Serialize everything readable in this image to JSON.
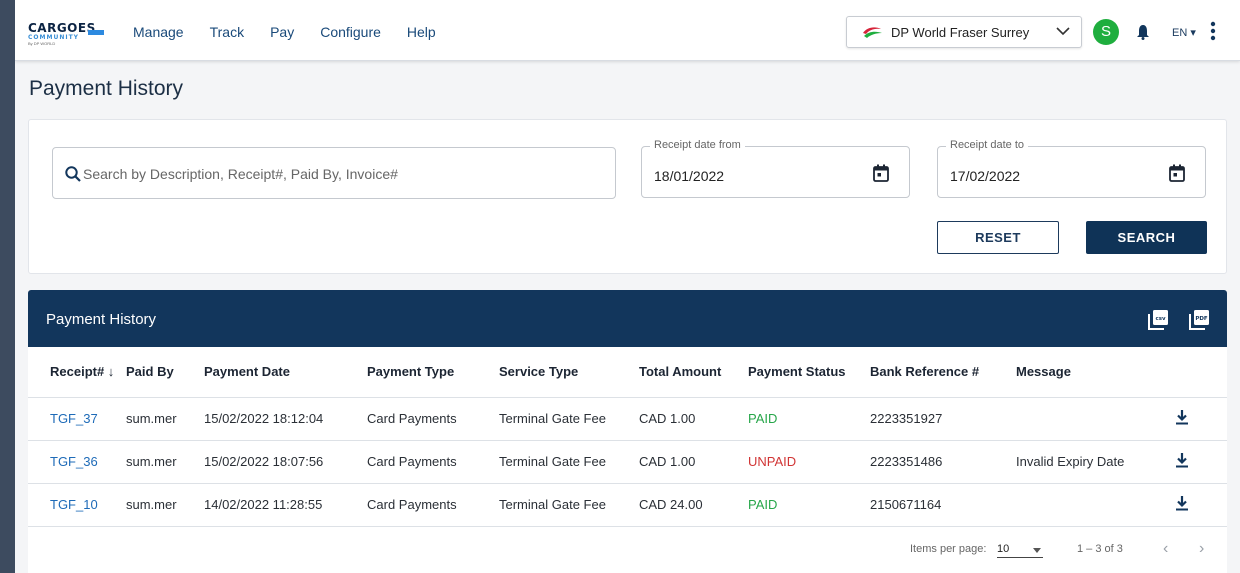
{
  "brand": {
    "line1": "CARGOES",
    "line2": "COMMUNITY",
    "line3": "By DP WORLD"
  },
  "nav": [
    "Manage",
    "Track",
    "Pay",
    "Configure",
    "Help"
  ],
  "terminal": {
    "selected": "DP World Fraser Surrey"
  },
  "user": {
    "initial": "S"
  },
  "language": "EN ▾",
  "page": {
    "title": "Payment History"
  },
  "filters": {
    "search_placeholder": "Search by Description, Receipt#, Paid By, Invoice#",
    "date_from": {
      "label": "Receipt date from",
      "value": "18/01/2022"
    },
    "date_to": {
      "label": "Receipt date to",
      "value": "17/02/2022"
    },
    "reset_label": "RESET",
    "search_label": "SEARCH"
  },
  "table": {
    "title": "Payment History",
    "export_icons": [
      "csv-export-icon",
      "pdf-export-icon"
    ],
    "columns": [
      "Receipt# ↓",
      "Paid By",
      "Payment Date",
      "Payment Type",
      "Service Type",
      "Total Amount",
      "Payment Status",
      "Bank Reference #",
      "Message"
    ],
    "rows": [
      {
        "receipt": "TGF_37",
        "paid_by": "sum.mer",
        "payment_date": "15/02/2022 18:12:04",
        "payment_type": "Card Payments",
        "service_type": "Terminal Gate Fee",
        "total_amount": "CAD 1.00",
        "status": "PAID",
        "bank_ref": "2223351927",
        "message": ""
      },
      {
        "receipt": "TGF_36",
        "paid_by": "sum.mer",
        "payment_date": "15/02/2022 18:07:56",
        "payment_type": "Card Payments",
        "service_type": "Terminal Gate Fee",
        "total_amount": "CAD 1.00",
        "status": "UNPAID",
        "bank_ref": "2223351486",
        "message": "Invalid Expiry Date"
      },
      {
        "receipt": "TGF_10",
        "paid_by": "sum.mer",
        "payment_date": "14/02/2022 11:28:55",
        "payment_type": "Card Payments",
        "service_type": "Terminal Gate Fee",
        "total_amount": "CAD 24.00",
        "status": "PAID",
        "bank_ref": "2150671164",
        "message": ""
      }
    ]
  },
  "pagination": {
    "items_per_page_label": "Items per page:",
    "items_per_page": "10",
    "range": "1 – 3 of 3",
    "prev": "‹",
    "next": "›"
  },
  "colors": {
    "primary": "#12365c",
    "paid": "#27a64a",
    "unpaid": "#d13535",
    "link": "#1e6bb8",
    "avatar": "#1fae3e"
  }
}
